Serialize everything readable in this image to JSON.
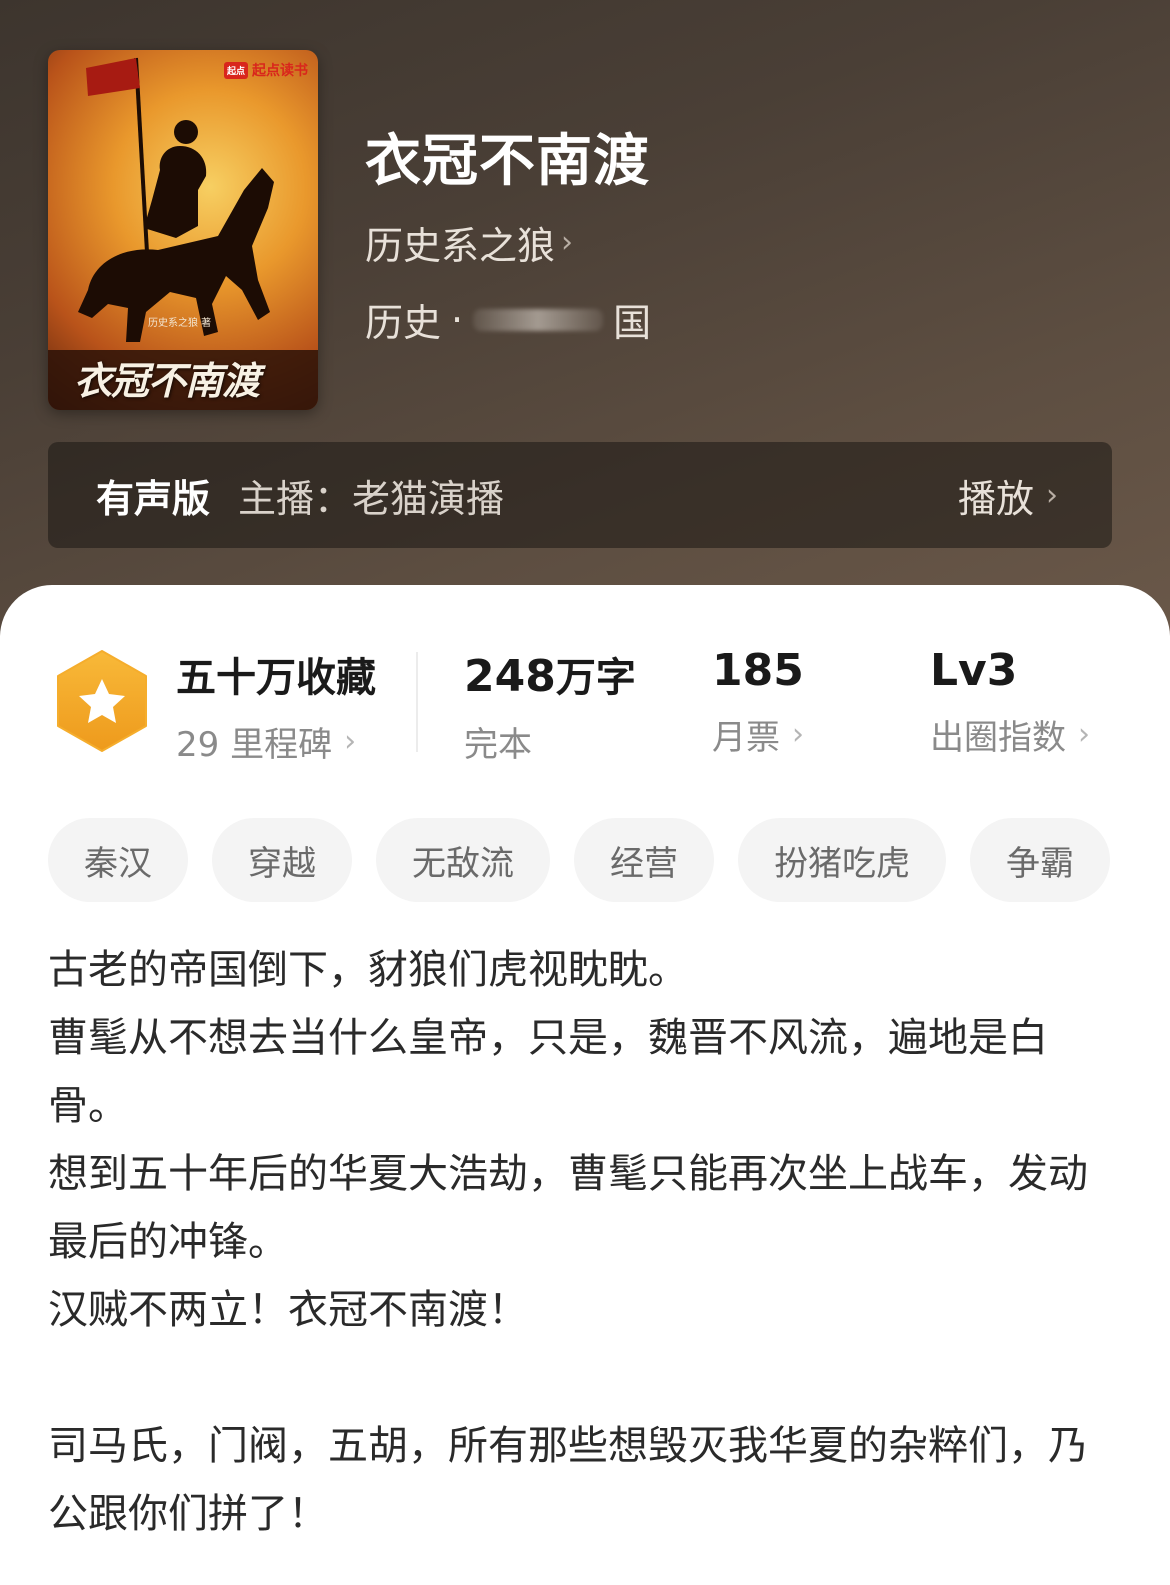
{
  "book": {
    "title": "衣冠不南渡",
    "author": "历史系之狼",
    "genre": "历史",
    "genre_separator": "·",
    "subgenre_visible": "国",
    "chevron": "›"
  },
  "cover": {
    "brand": "起点读书",
    "brand_badge": "起点",
    "author_credit": "历史系之狼 著",
    "title": "衣冠不南渡"
  },
  "audio": {
    "label": "有声版",
    "host": "主播：老猫演播",
    "play_label": "播放"
  },
  "stats": {
    "collections": {
      "value": "五十万收藏",
      "label": "29 里程碑"
    },
    "words": {
      "value": "248",
      "unit": "万字",
      "label": "完本"
    },
    "monthly_tickets": {
      "value": "185",
      "label": "月票"
    },
    "influence": {
      "value": "Lv3",
      "label": "出圈指数"
    }
  },
  "tags": [
    "秦汉",
    "穿越",
    "无敌流",
    "经营",
    "扮猪吃虎",
    "争霸"
  ],
  "synopsis": {
    "p1": "古老的帝国倒下，豺狼们虎视眈眈。",
    "p2": "曹髦从不想去当什么皇帝，只是，魏晋不风流，遍地是白骨。",
    "p3": "想到五十年后的华夏大浩劫，曹髦只能再次坐上战车，发动最后的冲锋。",
    "p4": "汉贼不两立！衣冠不南渡！",
    "p5": "司马氏，门阀，五胡，所有那些想毁灭我华夏的杂粹们，乃公跟你们拼了！"
  },
  "colors": {
    "hero_bg": "#4a3f36",
    "badge_orange": "#f3a524",
    "text_primary": "#1a1a1a",
    "text_secondary": "#8a8a8a",
    "tag_bg": "#f4f4f4"
  }
}
